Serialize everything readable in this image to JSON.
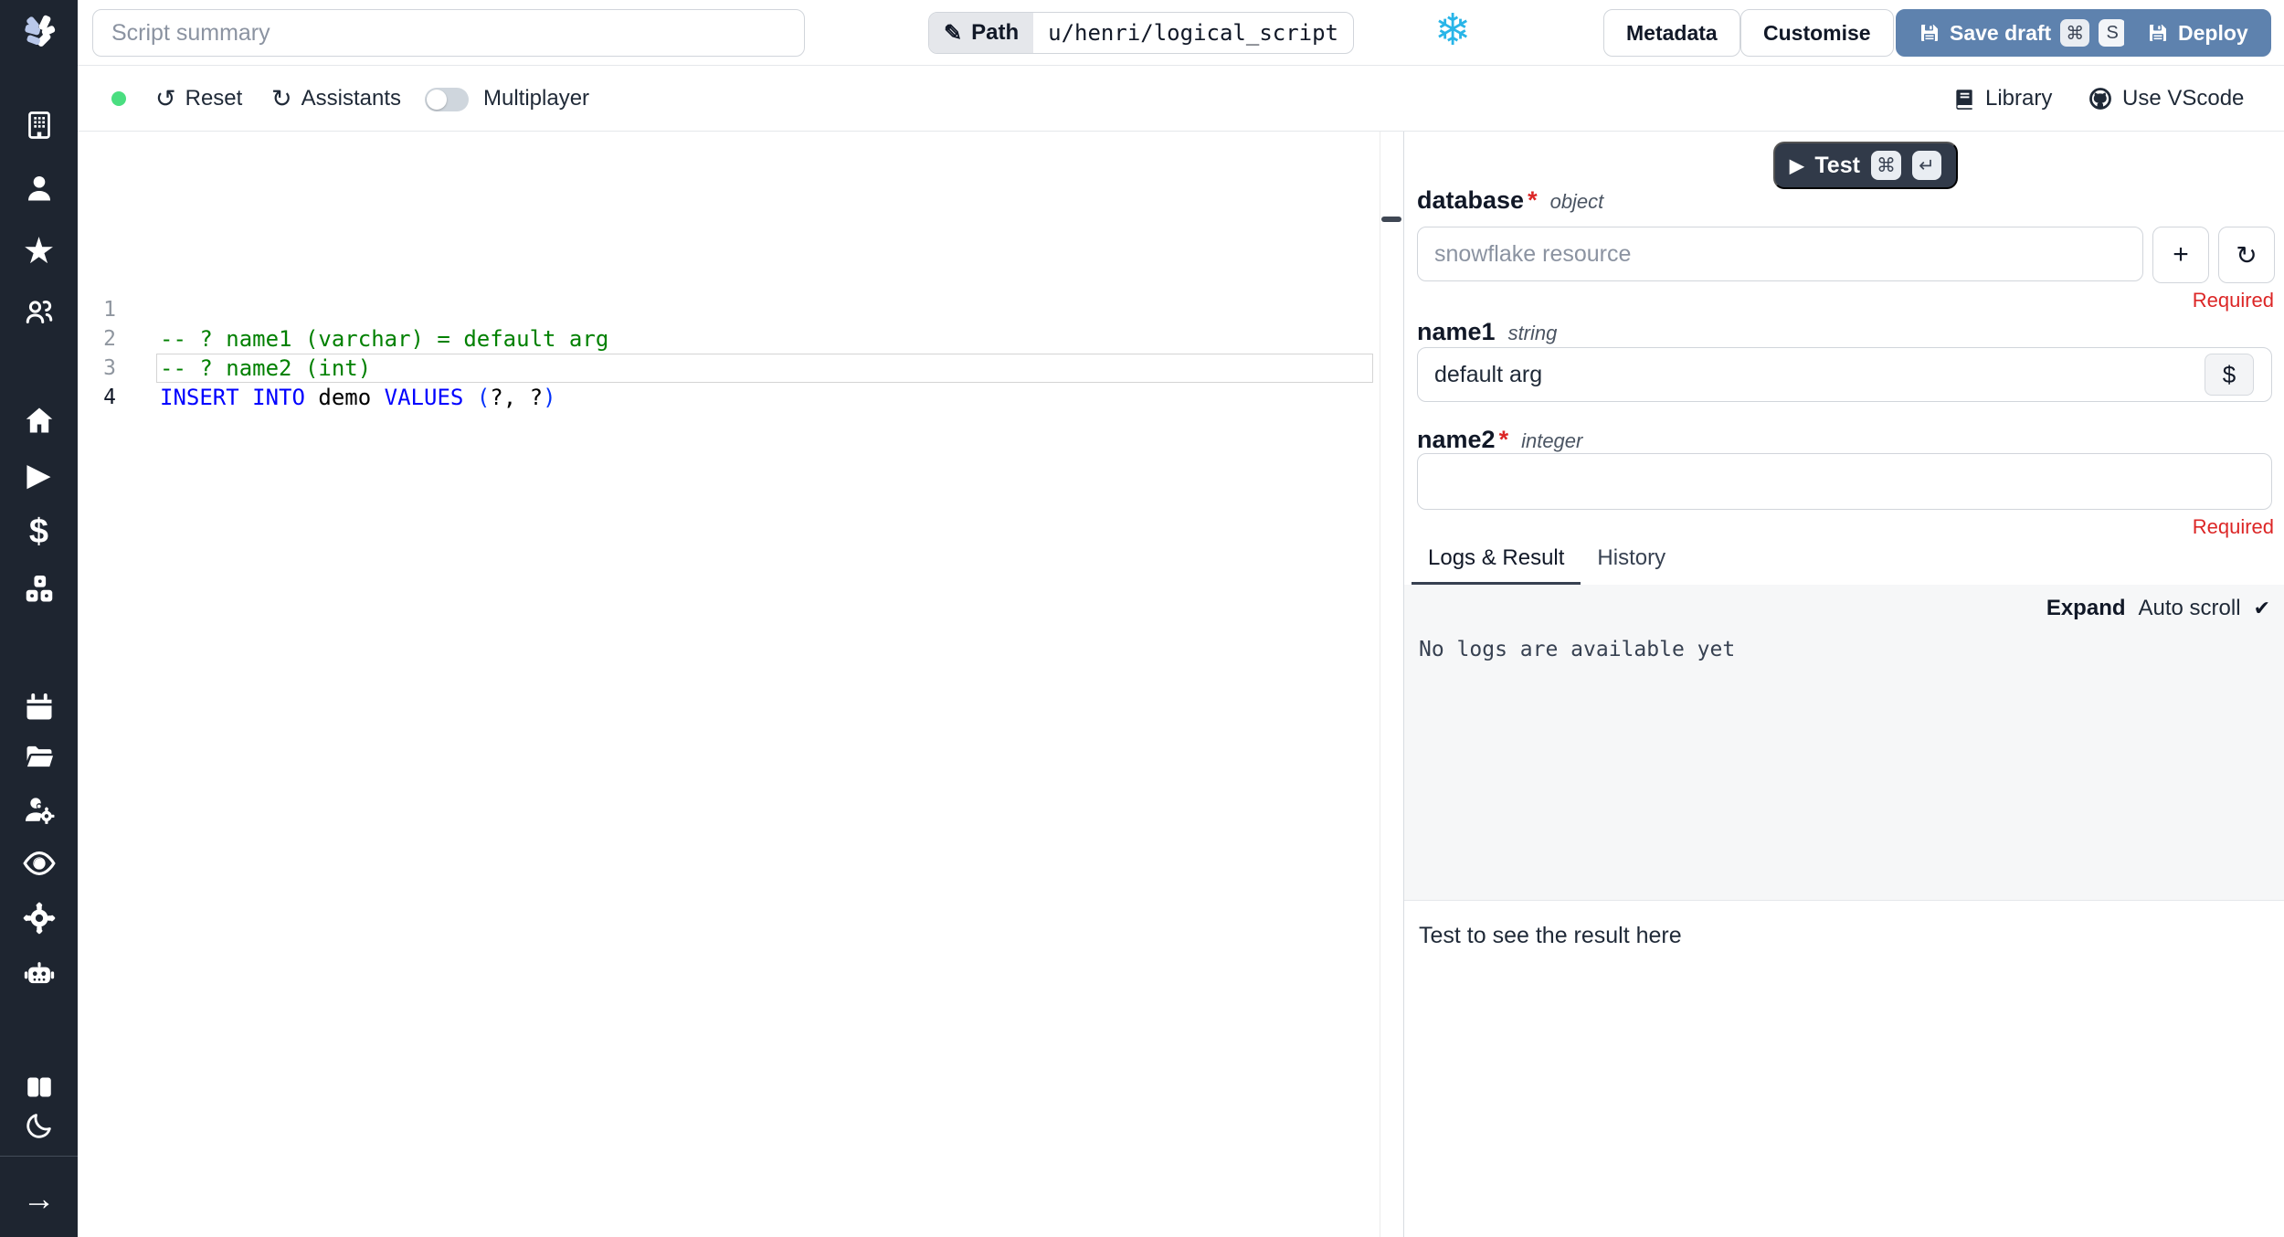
{
  "colors": {
    "sidebar_bg": "#1e2530",
    "accent": "#5e82ae",
    "dark_btn": "#313a49",
    "red": "#dc2626",
    "green_dot": "#4ade80",
    "snowflake": "#29b5e8",
    "logs_bg": "#f6f7f8"
  },
  "icons": {
    "snowflake": "❄",
    "pencil": "✎",
    "command": "⌘",
    "enter": "↵",
    "play": "▶",
    "reset": "↺",
    "assistants": "↻",
    "plus": "+",
    "refresh": "↻",
    "dollar": "$",
    "check": "✔",
    "arrow_right": "→",
    "star": "★",
    "sidebar_play": "▶",
    "sidebar_dollar": "$"
  },
  "topbar": {
    "summary_placeholder": "Script summary",
    "path_label": "Path",
    "path_value": "u/henri/logical_script",
    "metadata_label": "Metadata",
    "customise_label": "Customise",
    "save_draft_label": "Save draft",
    "save_kbd_1": "⌘",
    "save_kbd_2": "S",
    "deploy_label": "Deploy"
  },
  "toolbar": {
    "reset_label": "Reset",
    "assistants_label": "Assistants",
    "multiplayer_label": "Multiplayer",
    "library_label": "Library",
    "vscode_label": "Use VScode"
  },
  "editor": {
    "language": "sql",
    "lines": [
      {
        "number": "1",
        "tokens": [
          {
            "text": "-- ? name1 (varchar) = default arg"
          }
        ]
      },
      {
        "number": "2",
        "tokens": [
          {
            "text": "-- ? name2 (int)"
          }
        ]
      },
      {
        "number": "3",
        "tokens": [
          {
            "text": "INSERT INTO"
          },
          {
            "text": " demo "
          },
          {
            "text": "VALUES"
          },
          {
            "text": " "
          },
          {
            "text": "("
          },
          {
            "text": "?, ?"
          },
          {
            "text": ")"
          }
        ]
      },
      {
        "number": "4",
        "tokens": []
      }
    ]
  },
  "run_panel": {
    "test_label": "Test",
    "test_kbd_1": "⌘",
    "test_kbd_2": "↵",
    "args": [
      {
        "name": "database",
        "type": "object",
        "required_label": "Required",
        "placeholder": "snowflake resource",
        "value": ""
      },
      {
        "name": "name1",
        "type": "string",
        "value": "default arg",
        "dollar": "$"
      },
      {
        "name": "name2",
        "type": "integer",
        "required_label": "Required",
        "value": ""
      }
    ],
    "tabs": [
      {
        "label": "Logs & Result"
      },
      {
        "label": "History"
      }
    ],
    "logs": {
      "expand_label": "Expand",
      "autoscroll_label": "Auto scroll",
      "empty_text": "No logs are available yet"
    },
    "result_hint": "Test to see the result here"
  }
}
